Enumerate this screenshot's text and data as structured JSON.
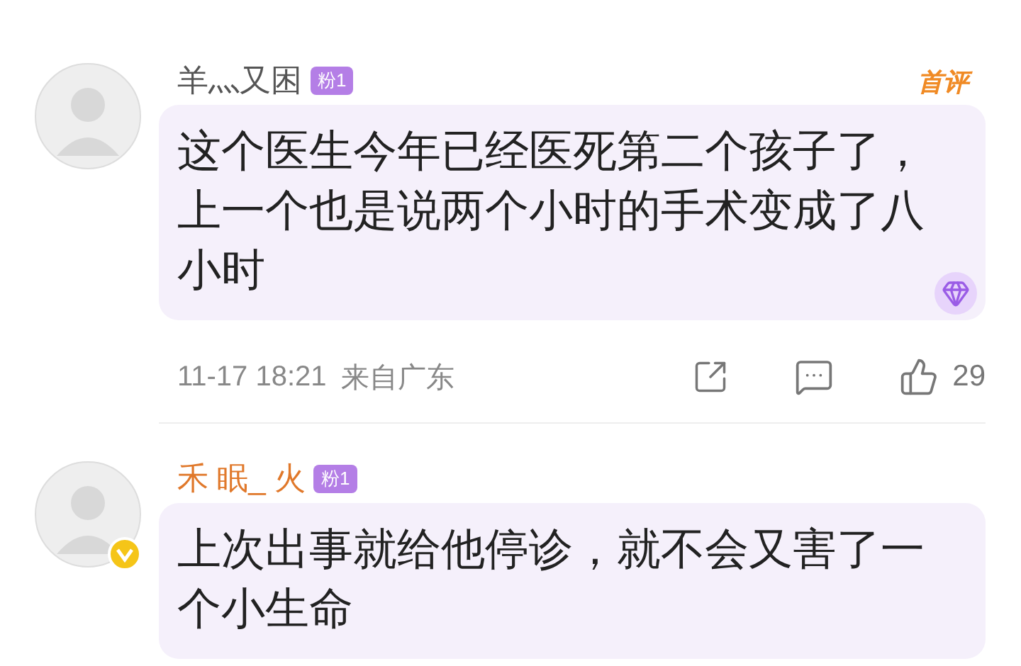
{
  "comments": [
    {
      "username": "羊灬又困",
      "vip": false,
      "verified": false,
      "fan_badge": "粉1",
      "tag": "首评",
      "text": "这个医生今年已经医死第二个孩子了，上一个也是说两个小时的手术变成了八小时",
      "gem": true,
      "time": "11-17 18:21",
      "location": "来自广东",
      "likes": "29"
    },
    {
      "username": "禾 眠_ 火",
      "vip": true,
      "verified": true,
      "fan_badge": "粉1",
      "text": "上次出事就给他停诊，就不会又害了一个小生命",
      "gem": false
    }
  ]
}
